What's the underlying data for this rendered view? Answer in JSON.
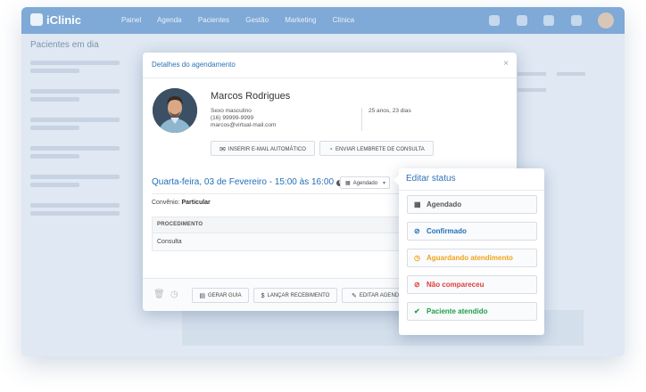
{
  "app": {
    "logo": "iClinic",
    "nav": [
      "Painel",
      "Agenda",
      "Pacientes",
      "Gestão",
      "Marketing",
      "Clínica"
    ],
    "page_title": "Pacientes em dia"
  },
  "modal": {
    "title": "Detalhes do agendamento",
    "close": "×",
    "patient": {
      "name": "Marcos Rodrigues",
      "sex": "Sexo masculino",
      "phone": "(16) 99999-9999",
      "email": "marcos@virtual-mail.com",
      "age": "25 anos, 23 dias"
    },
    "buttons": {
      "email": "INSERIR E-MAIL AUTOMÁTICO",
      "reminder": "ENVIAR LEMBRETE DE CONSULTA"
    },
    "date": "Quarta-feira, 03 de Fevereiro - 15:00 às 16:00",
    "status_select": "Agendado",
    "convenio_label": "Convênio:",
    "convenio_value": "Particular",
    "table": {
      "header": "PROCEDIMENTO",
      "rows": [
        "Consulta"
      ]
    },
    "footer": {
      "guide": "GERAR GUIA",
      "receipt": "LANÇAR RECEBIMENTO",
      "edit": "EDITAR AGEND"
    }
  },
  "status_panel": {
    "title": "Editar status",
    "options": [
      {
        "label": "Agendado",
        "color": "#555555",
        "icon": "calendar-icon"
      },
      {
        "label": "Confirmado",
        "color": "#1f6fb8",
        "icon": "check-circle-icon"
      },
      {
        "label": "Aguardando atendimento",
        "color": "#f0a31a",
        "icon": "clock-icon"
      },
      {
        "label": "Não compareceu",
        "color": "#e03a3a",
        "icon": "ban-icon"
      },
      {
        "label": "Paciente atendido",
        "color": "#1e9e4a",
        "icon": "check-icon"
      }
    ]
  }
}
